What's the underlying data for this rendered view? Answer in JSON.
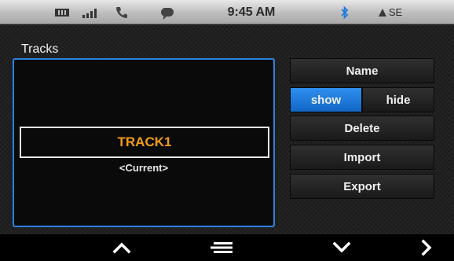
{
  "status_bar": {
    "time": "9:45 AM",
    "heading": "SE",
    "icons": [
      "battery-icon",
      "signal-icon",
      "phone-icon",
      "message-icon",
      "bluetooth-icon",
      "compass-arrow-icon"
    ]
  },
  "tracks": {
    "title": "Tracks",
    "items": [
      {
        "name": "TRACK1",
        "status": "<Current>"
      }
    ]
  },
  "actions": {
    "name_label": "Name",
    "show_label": "show",
    "hide_label": "hide",
    "delete_label": "Delete",
    "import_label": "Import",
    "export_label": "Export",
    "selected_visibility": "show"
  },
  "nav": {
    "icons": [
      "chevron-up-icon",
      "menu-icon",
      "chevron-down-icon",
      "chevron-right-icon"
    ]
  },
  "colors": {
    "accent_blue": "#2a82e0",
    "track_name": "#f39c1a",
    "background": "#1b1b1b"
  }
}
